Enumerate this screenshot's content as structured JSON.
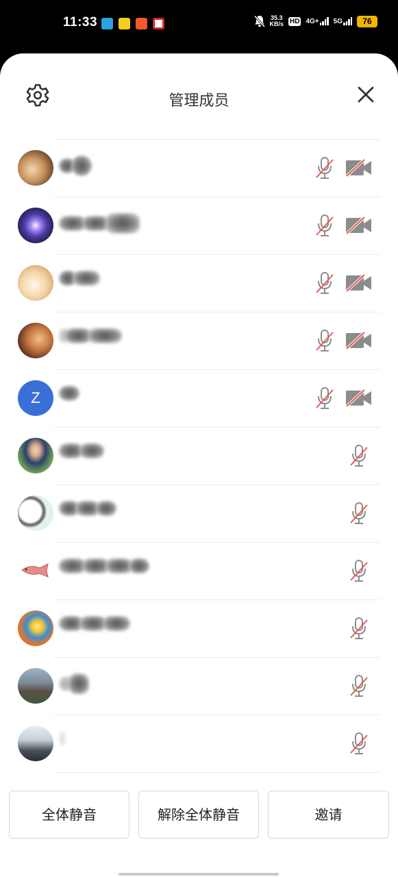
{
  "status_bar": {
    "time": "11:33",
    "speed_value": "35.3",
    "speed_unit": "KB/s",
    "hd_label": "HD",
    "hd_sub": "1\n2",
    "net1": "4G+",
    "net2": "5G",
    "battery": "76",
    "app_icons": [
      "telegram-icon",
      "app-yellow-icon",
      "taobao-icon",
      "app-red-icon"
    ]
  },
  "header": {
    "title": "管理成员",
    "settings_icon": "gear-icon",
    "close_icon": "close-icon"
  },
  "members": [
    {
      "avatar": "cat-photo",
      "mic_muted": true,
      "camera_off": true
    },
    {
      "avatar": "purple-planet",
      "mic_muted": true,
      "camera_off": true
    },
    {
      "avatar": "puppy-photo",
      "mic_muted": true,
      "camera_off": true
    },
    {
      "avatar": "cartoon-photo",
      "mic_muted": true,
      "camera_off": true
    },
    {
      "avatar": "letter",
      "letter": "Z",
      "mic_muted": true,
      "camera_off": true
    },
    {
      "avatar": "man-in-suit",
      "mic_muted": true
    },
    {
      "avatar": "panda-cartoon",
      "mic_muted": true
    },
    {
      "avatar": "fish-drawing",
      "mic_muted": true
    },
    {
      "avatar": "cartoon-eye",
      "mic_muted": true
    },
    {
      "avatar": "landscape-photo",
      "mic_muted": true
    },
    {
      "avatar": "winter-photo",
      "mic_muted": true
    }
  ],
  "buttons": {
    "mute_all": "全体静音",
    "unmute_all": "解除全体静音",
    "invite": "邀请"
  },
  "colors": {
    "accent_red": "#e85a4f",
    "icon_gray": "#8c8c8c",
    "letter_avatar": "#3a6fd8"
  }
}
